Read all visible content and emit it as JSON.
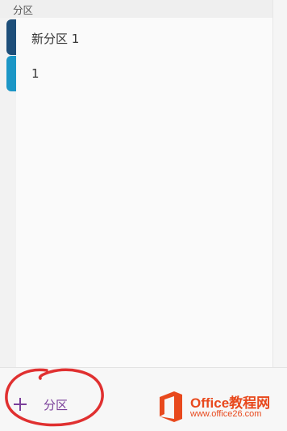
{
  "panel": {
    "title": "分区"
  },
  "sections": [
    {
      "label": "新分区 1",
      "color": "#1d4e79"
    },
    {
      "label": "1",
      "color": "#1b96c6"
    }
  ],
  "bottom": {
    "add_label": "分区"
  },
  "watermark": {
    "brand": "Office教程网",
    "site": "www.office26.com",
    "logo_color": "#e8491d"
  },
  "annotation": {
    "color": "#e03030"
  }
}
